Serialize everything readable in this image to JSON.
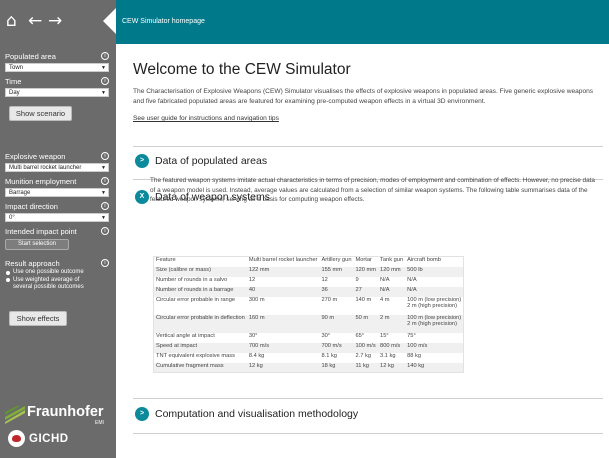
{
  "nav": {
    "home_icon": "home-icon",
    "back_icon": "arrow-left-icon",
    "forward_icon": "arrow-right-icon",
    "collapse_icon": "collapse-triangle-icon"
  },
  "header": {
    "title": "CEW Simulator homepage"
  },
  "sidebar": {
    "populated_area": {
      "label": "Populated area",
      "value": "Town"
    },
    "time": {
      "label": "Time",
      "value": "Day"
    },
    "show_scenario": "Show scenario",
    "explosive_weapon": {
      "label": "Explosive weapon",
      "value": "Multi barrel rocket launcher"
    },
    "munition_employment": {
      "label": "Munition employment",
      "value": "Barrage"
    },
    "impact_direction": {
      "label": "Impact direction",
      "value": "0°"
    },
    "intended_impact_point": {
      "label": "Intended impact point",
      "button": "Start selection"
    },
    "result_approach": {
      "label": "Result approach",
      "option1": "Use one possible outcome",
      "option2_line1": "Use weighted average of",
      "option2_line2": "several possible outcomes"
    },
    "show_effects": "Show effects",
    "info_glyph": "i",
    "caret": "▼"
  },
  "logos": {
    "fraunhofer": "Fraunhofer",
    "fraunhofer_sub": "EMI",
    "gichd": "GICHD"
  },
  "main": {
    "title": "Welcome to the CEW Simulator",
    "intro": "The Characterisation of Explosive Weapons (CEW) Simulator visualises the effects of explosive weapons in populated areas. Five generic explosive weapons and five fabricated populated areas are featured for examining pre-computed weapon effects in a virtual 3D environment.",
    "guide_link": "See user guide for instructions and navigation tips",
    "sections": [
      {
        "icon": ">",
        "title": "Data of populated areas"
      },
      {
        "icon": "X",
        "title": "Data of weapon systems"
      },
      {
        "icon": ">",
        "title": "Computation and visualisation methodology"
      }
    ],
    "weapon_desc": "The featured weapon systems imitate actual characteristics in terms of precision, modes of employment and combination of effects. However, no precise data of a weapon model is used. Instead, average values are calculated from a selection of similar weapon systems. The following table summarises data of the featured weapon systems, serving as a basis for computing weapon effects.",
    "table": {
      "headers": [
        "Feature",
        "Multi barrel rocket launcher",
        "Artillery gun",
        "Mortar",
        "Tank gun",
        "Aircraft bomb"
      ],
      "rows": [
        [
          "Size (calibre or mass)",
          "122 mm",
          "155 mm",
          "120 mm",
          "120 mm",
          "500 lb"
        ],
        [
          "Number of rounds in a salvo",
          "12",
          "12",
          "9",
          "N/A",
          "N/A"
        ],
        [
          "Number of rounds in a barrage",
          "40",
          "36",
          "27",
          "N/A",
          "N/A"
        ],
        [
          "Circular error probable in range",
          "300 m",
          "270 m",
          "140 m",
          "4 m",
          "100 m (low precision)",
          "2 m (high precision)"
        ],
        [
          "Circular error probable in deflection",
          "160 m",
          "90 m",
          "50 m",
          "2 m",
          "100 m (low precision)",
          "2 m (high precision)"
        ],
        [
          "Vertical angle at impact",
          "30°",
          "30°",
          "65°",
          "15°",
          "75°"
        ],
        [
          "Speed at impact",
          "700 m/s",
          "700 m/s",
          "100 m/s",
          "800 m/s",
          "100 m/s"
        ],
        [
          "TNT equivalent explosive mass",
          "8.4 kg",
          "8.1 kg",
          "2.7 kg",
          "3.1 kg",
          "88 kg"
        ],
        [
          "Cumulative fragment mass",
          "12 kg",
          "18 kg",
          "11 kg",
          "12 kg",
          "140 kg"
        ]
      ]
    }
  },
  "colors": {
    "sidebar": "#6b6b6b",
    "topbar": "#007a8a",
    "accent": "#0a8a9a"
  }
}
